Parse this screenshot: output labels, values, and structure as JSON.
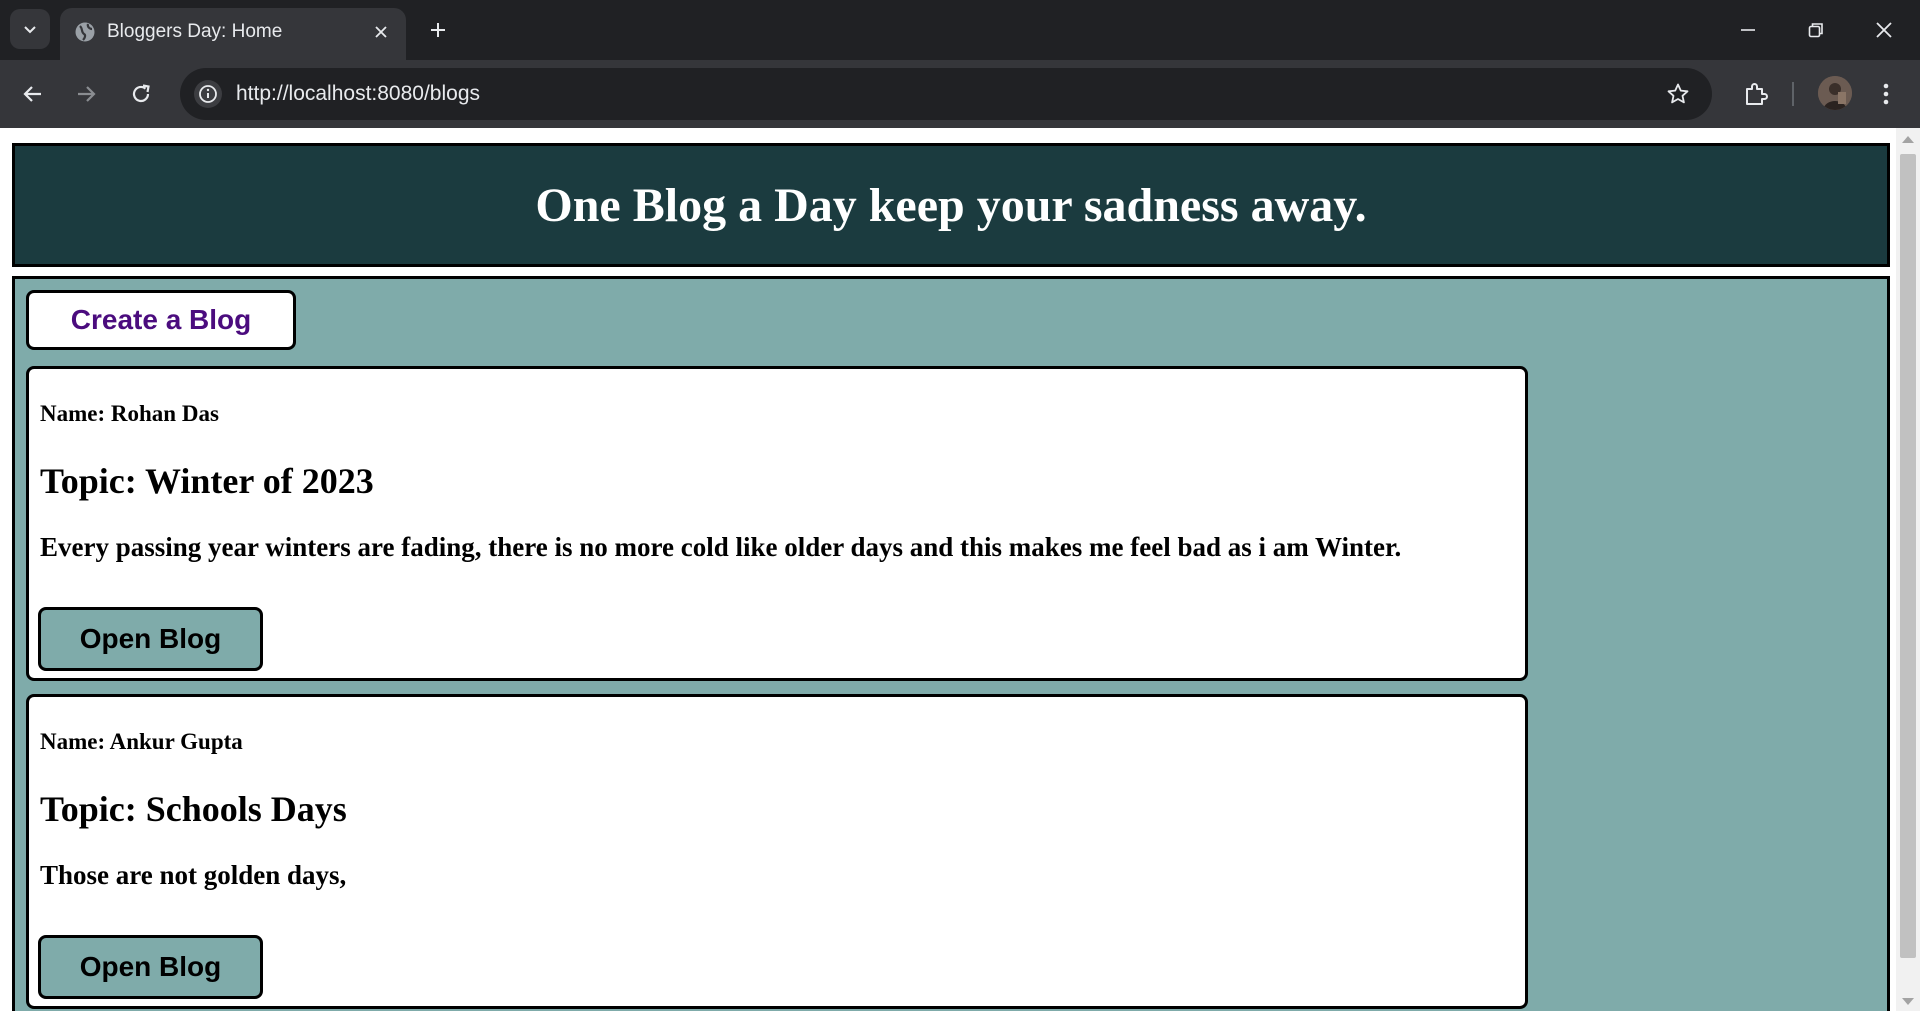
{
  "browser": {
    "tab_title": "Bloggers Day: Home",
    "url": "http://localhost:8080/blogs"
  },
  "page": {
    "header_title": "One Blog a Day keep your sadness away.",
    "create_button_label": "Create a Blog",
    "blogs": [
      {
        "name": "Name: Rohan Das",
        "topic": "Topic: Winter of 2023",
        "body": "Every passing year winters are fading, there is no more cold like older days and this makes me feel bad as i am Winter.",
        "button_label": "Open Blog"
      },
      {
        "name": "Name: Ankur Gupta",
        "topic": "Topic: Schools Days",
        "body": "Those are not golden days,",
        "button_label": "Open Blog"
      }
    ]
  },
  "colors": {
    "header_bg": "#1b3b3f",
    "content_bg": "#7fabaa",
    "create_button_text": "#4b0c7e",
    "browser_dark": "#202124",
    "browser_toolbar": "#35363a"
  },
  "icons": [
    "tab-search-icon",
    "globe-favicon-icon",
    "close-icon",
    "plus-icon",
    "minimize-icon",
    "restore-icon",
    "window-close-icon",
    "back-arrow-icon",
    "forward-arrow-icon",
    "reload-icon",
    "info-icon",
    "star-icon",
    "extensions-icon",
    "avatar",
    "kebab-menu-icon"
  ]
}
